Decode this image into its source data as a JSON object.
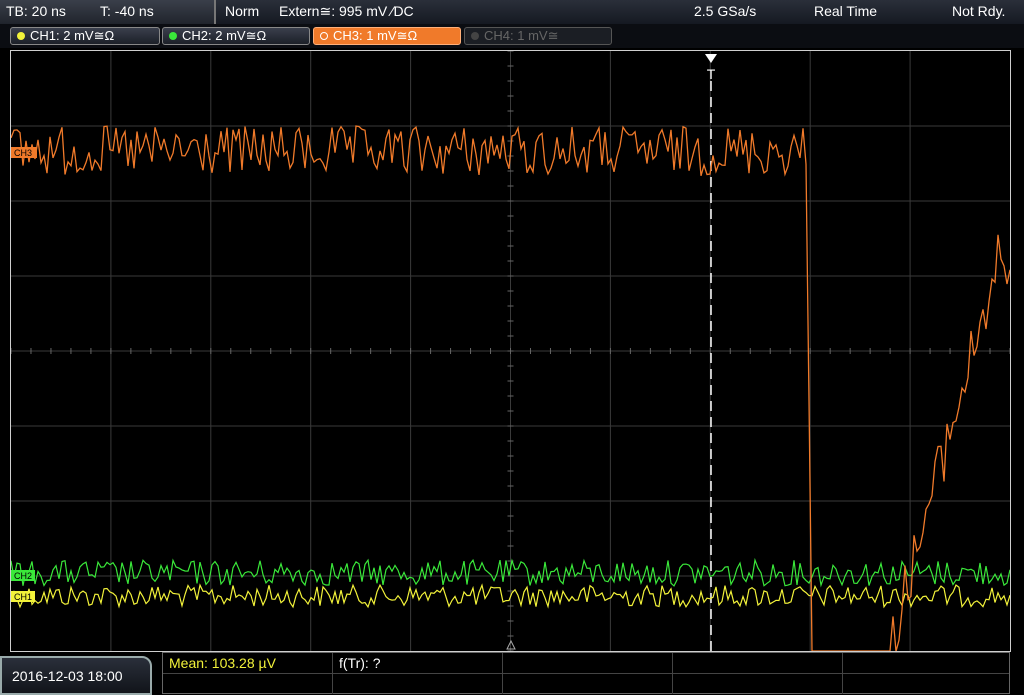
{
  "status": {
    "timebase": "TB: 20 ns",
    "trigger_offset": "T: -40 ns",
    "mode": "Norm",
    "trigger_source": "Extern≅: 995 mV ∕DC",
    "sample_rate": "2.5 GSa/s",
    "acq_mode": "Real Time",
    "trigger_state": "Not Rdy."
  },
  "channels": [
    {
      "label": "CH1: 2 mV≅Ω",
      "color": "#f2f23a",
      "state": "on"
    },
    {
      "label": "CH2: 2 mV≅Ω",
      "color": "#3ae83a",
      "state": "on"
    },
    {
      "label": "CH3: 1 mV≅Ω",
      "color": "#f07a2a",
      "state": "active"
    },
    {
      "label": "CH4: 1 mV≅",
      "color": "#666666",
      "state": "off"
    }
  ],
  "markers": {
    "ch3": "CH3",
    "ch2": "CH2",
    "ch1": "CH1",
    "trigger": "T"
  },
  "measurements": {
    "mean": "Mean: 103.28 µV",
    "freq": "f(Tr): ?"
  },
  "datetime": "2016-12-03 18:00",
  "colors": {
    "ch1": "#f2f23a",
    "ch2": "#3ae83a",
    "ch3": "#f07a2a",
    "grid": "#3a3a3a"
  }
}
